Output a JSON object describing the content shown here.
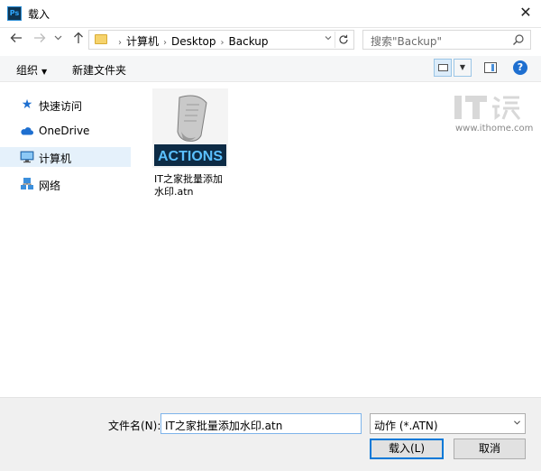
{
  "window": {
    "title": "载入",
    "app_icon_text": "Ps",
    "close_label": "✕"
  },
  "nav": {
    "back_icon": "arrow-left-icon",
    "forward_icon": "arrow-right-icon",
    "recent_icon": "chevron-down-icon",
    "up_icon": "arrow-up-icon",
    "breadcrumbs": [
      "计算机",
      "Desktop",
      "Backup"
    ],
    "search_placeholder": "搜索\"Backup\""
  },
  "toolbar": {
    "organize_label": "组织",
    "new_folder_label": "新建文件夹"
  },
  "sidebar": {
    "items": [
      {
        "label": "快速访问",
        "icon": "star-icon"
      },
      {
        "label": "OneDrive",
        "icon": "cloud-icon"
      },
      {
        "label": "计算机",
        "icon": "computer-icon",
        "selected": true
      },
      {
        "label": "网络",
        "icon": "network-icon"
      }
    ]
  },
  "files": [
    {
      "name": "IT之家批量添加水印.atn",
      "thumb_text": "ACTIONS",
      "icon": "actions-file-icon"
    }
  ],
  "watermark": {
    "site": "www.ithome.com"
  },
  "footer": {
    "filename_label": "文件名(N):",
    "filename_value": "IT之家批量添加水印.atn",
    "filetype_value": "动作 (*.ATN)",
    "load_label": "载入(L)",
    "cancel_label": "取消"
  },
  "colors": {
    "accent": "#0078d7",
    "selection": "#e5f1fb",
    "thumb_bg": "#0d2b45",
    "thumb_text": "#5bc0ff"
  }
}
